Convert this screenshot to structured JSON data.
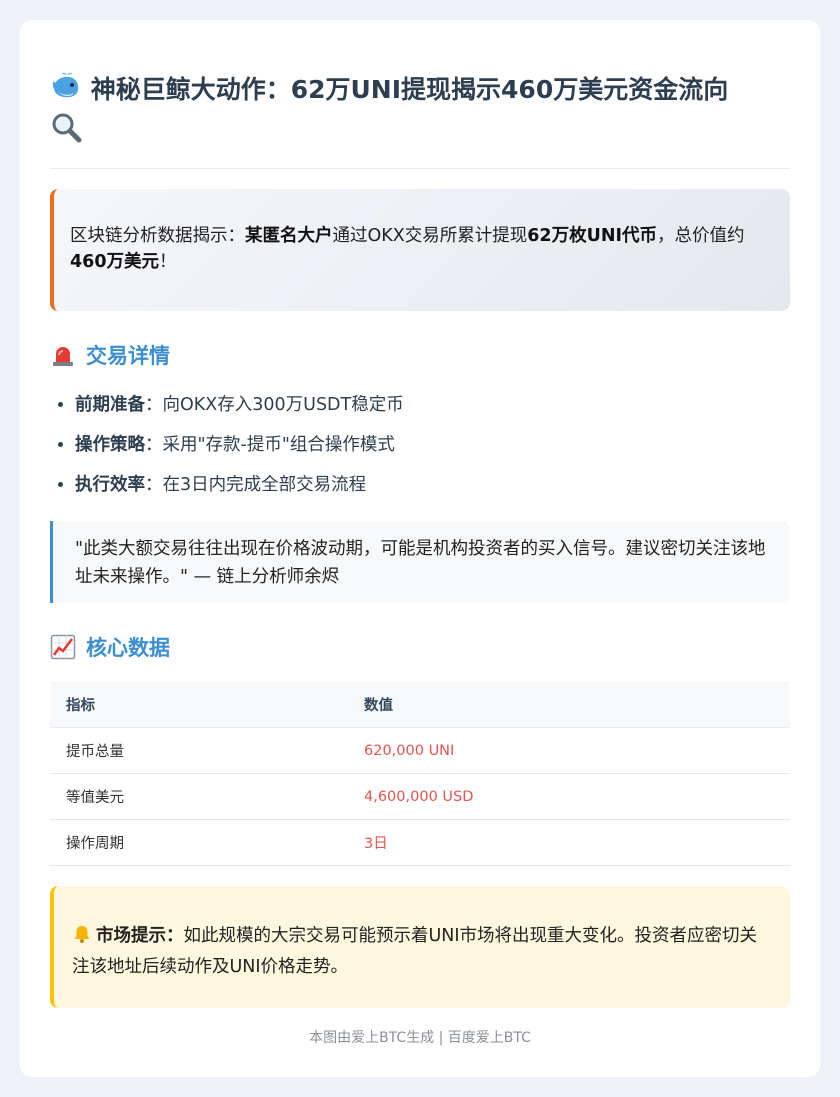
{
  "header": {
    "title": "神秘巨鲸大动作：62万UNI提现揭示460万美元资金流向",
    "title_icons": [
      "whale-icon",
      "magnifier-icon"
    ]
  },
  "intro": {
    "prefix": "区块链分析数据揭示：",
    "actor": "某匿名大户",
    "mid": "通过OKX交易所累计提现",
    "amount": "62万枚UNI代币",
    "mid2": "，总价值约",
    "value": "460万美元",
    "suffix": "！",
    "accent_color": "#f26b1d"
  },
  "details_section": {
    "icon": "siren-icon",
    "heading": "交易详情",
    "items": [
      {
        "label": "前期准备",
        "sep": "：",
        "text": "向OKX存入300万USDT稳定币"
      },
      {
        "label": "操作策略",
        "sep": "：",
        "text": "采用\"存款-提币\"组合操作模式"
      },
      {
        "label": "执行效率",
        "sep": "：",
        "text": "在3日内完成全部交易流程"
      }
    ]
  },
  "quote": {
    "text": "\"此类大额交易往往出现在价格波动期，可能是机构投资者的买入信号。建议密切关注该地址未来操作。\" — 链上分析师余烬"
  },
  "data_section": {
    "icon": "chart-increasing-icon",
    "heading": "核心数据",
    "columns": [
      "指标",
      "数值"
    ],
    "rows": [
      {
        "metric": "提币总量",
        "value": "620,000 UNI"
      },
      {
        "metric": "等值美元",
        "value": "4,600,000 USD"
      },
      {
        "metric": "操作周期",
        "value": "3日"
      }
    ],
    "value_color": "#e0564e"
  },
  "alert": {
    "icon": "bell-icon",
    "label": "市场提示：",
    "text": "如此规模的大宗交易可能预示着UNI市场将出现重大变化。投资者应密切关注该地址后续动作及UNI价格走势。",
    "accent_color": "#ffc107"
  },
  "footer": {
    "text": "本图由爱上BTC生成 | 百度爱上BTC"
  }
}
